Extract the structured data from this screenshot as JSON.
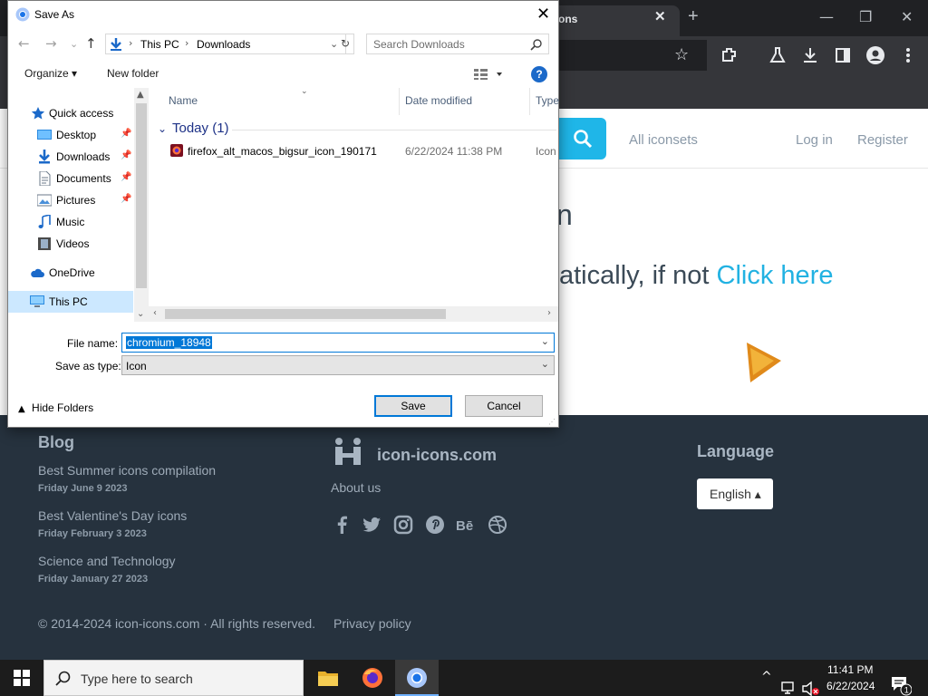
{
  "browser": {
    "tab_title": "ons",
    "tab_close": "✕",
    "new_tab": "+",
    "minimize": "—",
    "restore": "❐",
    "close": "✕"
  },
  "site": {
    "nav": {
      "iconsets": "All iconsets",
      "login": "Log in",
      "register": "Register"
    },
    "heading": "n",
    "redirect_text": "atically, if not ",
    "redirect_link": "Click here",
    "footer": {
      "blog_title": "Blog",
      "posts": [
        {
          "title": "Best Summer icons compilation",
          "date": "Friday June 9 2023"
        },
        {
          "title": "Best Valentine's Day icons",
          "date": "Friday February 3 2023"
        },
        {
          "title": "Science and Technology",
          "date": "Friday January 27 2023"
        }
      ],
      "brand": "icon-icons.com",
      "about": "About us",
      "language_title": "Language",
      "language_value": "English ▴",
      "copyright": "© 2014-2024 icon-icons.com · All rights reserved.",
      "privacy": "Privacy policy"
    }
  },
  "dialog": {
    "title": "Save As",
    "close": "✕",
    "breadcrumb": [
      "This PC",
      "Downloads"
    ],
    "search_placeholder": "Search Downloads",
    "organize": "Organize ▾",
    "new_folder": "New folder",
    "help": "?",
    "nav_items": [
      {
        "label": "Quick access",
        "icon": "star-icon"
      },
      {
        "label": "Desktop",
        "icon": "desktop-icon",
        "pinned": true
      },
      {
        "label": "Downloads",
        "icon": "download-arrow-icon",
        "pinned": true
      },
      {
        "label": "Documents",
        "icon": "document-icon",
        "pinned": true
      },
      {
        "label": "Pictures",
        "icon": "picture-icon",
        "pinned": true
      },
      {
        "label": "Music",
        "icon": "music-note-icon"
      },
      {
        "label": "Videos",
        "icon": "video-icon"
      },
      {
        "label": "OneDrive",
        "icon": "cloud-icon"
      },
      {
        "label": "This PC",
        "icon": "computer-icon",
        "selected": true
      }
    ],
    "columns": [
      "Name",
      "Date modified",
      "Type"
    ],
    "group": "Today (1)",
    "files": [
      {
        "name": "firefox_alt_macos_bigsur_icon_190171",
        "date": "6/22/2024 11:38 PM",
        "type": "Icon"
      }
    ],
    "file_name_label": "File name:",
    "file_name_value": "chromium_18948",
    "save_type_label": "Save as type:",
    "save_type_value": "Icon",
    "hide_folders": "Hide Folders",
    "save_button": "Save",
    "cancel_button": "Cancel"
  },
  "taskbar": {
    "search_placeholder": "Type here to search",
    "time": "11:41 PM",
    "date": "6/22/2024",
    "notification_count": "1"
  },
  "colors": {
    "accent": "#0078d7",
    "site_link": "#22b2e2",
    "footer_bg": "#26323e",
    "chrome_dark": "#35363a"
  }
}
